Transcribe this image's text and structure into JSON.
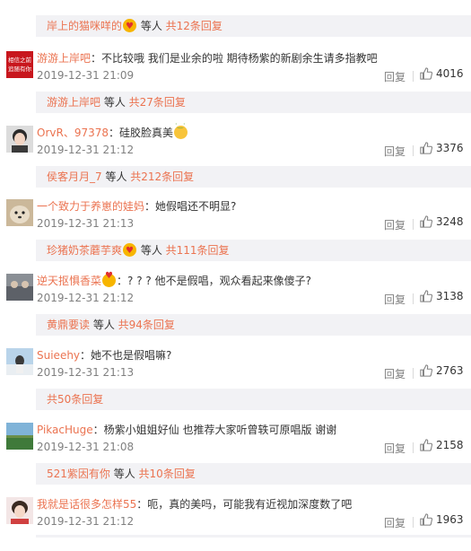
{
  "comments": [
    {
      "name": "游游上岸吧",
      "sep": "：",
      "text": "不比较哦   我们是业余的啦  期待杨紫的新剧余生请多指教吧",
      "time": "2019-12-31 21:09",
      "reply": "回复",
      "likes": "4016",
      "avatar_text": "相信之前\n追随有你"
    },
    {
      "name": "OrvR、97378",
      "sep": "：",
      "text": "硅胶脸真美",
      "time": "2019-12-31 21:12",
      "reply": "回复",
      "likes": "3376"
    },
    {
      "name": "一个致力于养崽的娃妈",
      "sep": "：",
      "text": "她假唱还不明显?",
      "time": "2019-12-31 21:13",
      "reply": "回复",
      "likes": "3248"
    },
    {
      "name": "逆天抠惧香菜",
      "sep": "：",
      "text": "? ? ? 他不是假唱，观众看起来像傻子?",
      "time": "2019-12-31 21:12",
      "reply": "回复",
      "likes": "3138"
    },
    {
      "name": "Suieehy",
      "sep": "：",
      "text": "她不也是假唱嘛?",
      "time": "2019-12-31 21:13",
      "reply": "回复",
      "likes": "2763"
    },
    {
      "name": "PikacHuge",
      "sep": "：",
      "text": "杨紫小姐姐好仙 也推荐大家听曾轶可原唱版 谢谢",
      "time": "2019-12-31 21:08",
      "reply": "回复",
      "likes": "2158"
    },
    {
      "name": "我就是话很多怎样55",
      "sep": "：",
      "text": "呃，真的美吗，可能我有近视加深度数了吧",
      "time": "2019-12-31 21:12",
      "reply": "回复",
      "likes": "1963"
    }
  ],
  "replies": [
    {
      "user": "岸上的猫咪咩的",
      "middle": " 等人 ",
      "count": "共12条回复"
    },
    {
      "user": "游游上岸吧",
      "middle": " 等人 ",
      "count": "共27条回复"
    },
    {
      "user": "侯客月月_7",
      "middle": " 等人 ",
      "count": "共212条回复"
    },
    {
      "user": "珍猪奶茶蘑芋爽",
      "middle": " 等人 ",
      "count": "共111条回复"
    },
    {
      "user": "黄鼎要读",
      "middle": " 等人 ",
      "count": "共94条回复"
    },
    {
      "user": "",
      "middle": "",
      "count": "共50条回复"
    },
    {
      "user": "521紫因有你",
      "middle": " 等人 ",
      "count": "共10条回复"
    }
  ],
  "top_partial_likes": "4016",
  "colors": {
    "link": "#eb7350",
    "muted": "#808080",
    "reply_bg": "#f2f2f5"
  }
}
